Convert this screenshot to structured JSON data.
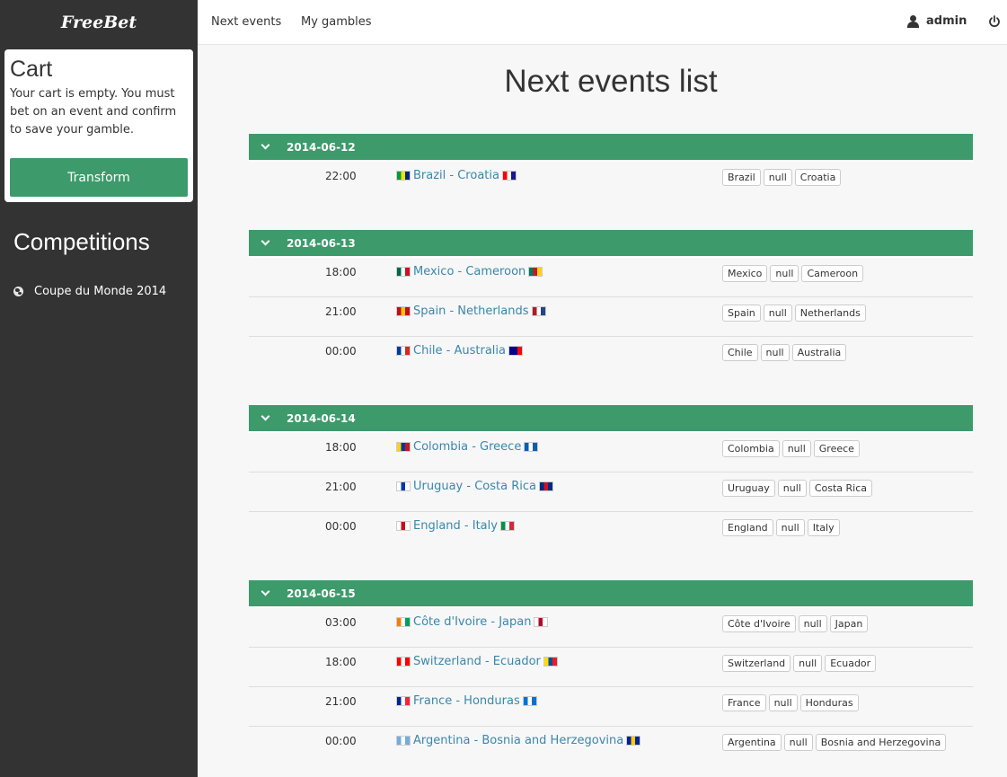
{
  "brand": "FreeBet",
  "cart": {
    "title": "Cart",
    "text": "Your cart is empty. You must bet on an event and confirm to save your gamble.",
    "button": "Transform"
  },
  "competitions": {
    "title": "Competitions",
    "items": [
      "Coupe du Monde 2014"
    ]
  },
  "nav": {
    "next_events": "Next events",
    "my_gambles": "My gambles",
    "user": "admin"
  },
  "page_title": "Next events list",
  "days": [
    {
      "date": "2014-06-12",
      "events": [
        {
          "time": "22:00",
          "home": "Brazil",
          "away": "Croatia",
          "match": "Brazil - Croatia",
          "home_flag": [
            "#009c3b",
            "#ffdf00",
            "#002776"
          ],
          "away_flag": [
            "#ff0000",
            "#ffffff",
            "#171796"
          ],
          "bets": [
            "Brazil",
            "null",
            "Croatia"
          ]
        }
      ]
    },
    {
      "date": "2014-06-13",
      "events": [
        {
          "time": "18:00",
          "home": "Mexico",
          "away": "Cameroon",
          "match": "Mexico - Cameroon",
          "home_flag": [
            "#006847",
            "#ffffff",
            "#ce1126"
          ],
          "away_flag": [
            "#007a5e",
            "#ce1126",
            "#fcd116"
          ],
          "bets": [
            "Mexico",
            "null",
            "Cameroon"
          ]
        },
        {
          "time": "21:00",
          "home": "Spain",
          "away": "Netherlands",
          "match": "Spain - Netherlands",
          "home_flag": [
            "#c60b1e",
            "#ffc400",
            "#c60b1e"
          ],
          "away_flag": [
            "#ae1c28",
            "#ffffff",
            "#21468b"
          ],
          "bets": [
            "Spain",
            "null",
            "Netherlands"
          ]
        },
        {
          "time": "00:00",
          "home": "Chile",
          "away": "Australia",
          "match": "Chile - Australia",
          "home_flag": [
            "#0039a6",
            "#ffffff",
            "#d52b1e"
          ],
          "away_flag": [
            "#00008b",
            "#00008b",
            "#ff0000"
          ],
          "bets": [
            "Chile",
            "null",
            "Australia"
          ]
        }
      ]
    },
    {
      "date": "2014-06-14",
      "events": [
        {
          "time": "18:00",
          "home": "Colombia",
          "away": "Greece",
          "match": "Colombia - Greece",
          "home_flag": [
            "#fcd116",
            "#003893",
            "#ce1126"
          ],
          "away_flag": [
            "#0d5eaf",
            "#ffffff",
            "#0d5eaf"
          ],
          "bets": [
            "Colombia",
            "null",
            "Greece"
          ]
        },
        {
          "time": "21:00",
          "home": "Uruguay",
          "away": "Costa Rica",
          "match": "Uruguay - Costa Rica",
          "home_flag": [
            "#ffffff",
            "#0038a8",
            "#ffffff"
          ],
          "away_flag": [
            "#002b7f",
            "#ce1126",
            "#002b7f"
          ],
          "bets": [
            "Uruguay",
            "null",
            "Costa Rica"
          ]
        },
        {
          "time": "00:00",
          "home": "England",
          "away": "Italy",
          "match": "England - Italy",
          "home_flag": [
            "#ffffff",
            "#cf081f",
            "#ffffff"
          ],
          "away_flag": [
            "#009246",
            "#ffffff",
            "#ce2b37"
          ],
          "bets": [
            "England",
            "null",
            "Italy"
          ]
        }
      ]
    },
    {
      "date": "2014-06-15",
      "events": [
        {
          "time": "03:00",
          "home": "Côte d'Ivoire",
          "away": "Japan",
          "match": "Côte d'Ivoire - Japan",
          "home_flag": [
            "#f77f00",
            "#ffffff",
            "#009e60"
          ],
          "away_flag": [
            "#ffffff",
            "#bc002d",
            "#ffffff"
          ],
          "bets": [
            "Côte d'Ivoire",
            "null",
            "Japan"
          ]
        },
        {
          "time": "18:00",
          "home": "Switzerland",
          "away": "Ecuador",
          "match": "Switzerland - Ecuador",
          "home_flag": [
            "#ff0000",
            "#ffffff",
            "#ff0000"
          ],
          "away_flag": [
            "#ffdd00",
            "#034ea2",
            "#ed1c24"
          ],
          "bets": [
            "Switzerland",
            "null",
            "Ecuador"
          ]
        },
        {
          "time": "21:00",
          "home": "France",
          "away": "Honduras",
          "match": "France - Honduras",
          "home_flag": [
            "#002395",
            "#ffffff",
            "#ed2939"
          ],
          "away_flag": [
            "#0073cf",
            "#ffffff",
            "#0073cf"
          ],
          "bets": [
            "France",
            "null",
            "Honduras"
          ]
        },
        {
          "time": "00:00",
          "home": "Argentina",
          "away": "Bosnia and Herzegovina",
          "match": "Argentina - Bosnia and Herzegovina",
          "home_flag": [
            "#74acdf",
            "#ffffff",
            "#74acdf"
          ],
          "away_flag": [
            "#002395",
            "#fecb00",
            "#002395"
          ],
          "bets": [
            "Argentina",
            "null",
            "Bosnia and Herzegovina"
          ]
        }
      ]
    }
  ]
}
